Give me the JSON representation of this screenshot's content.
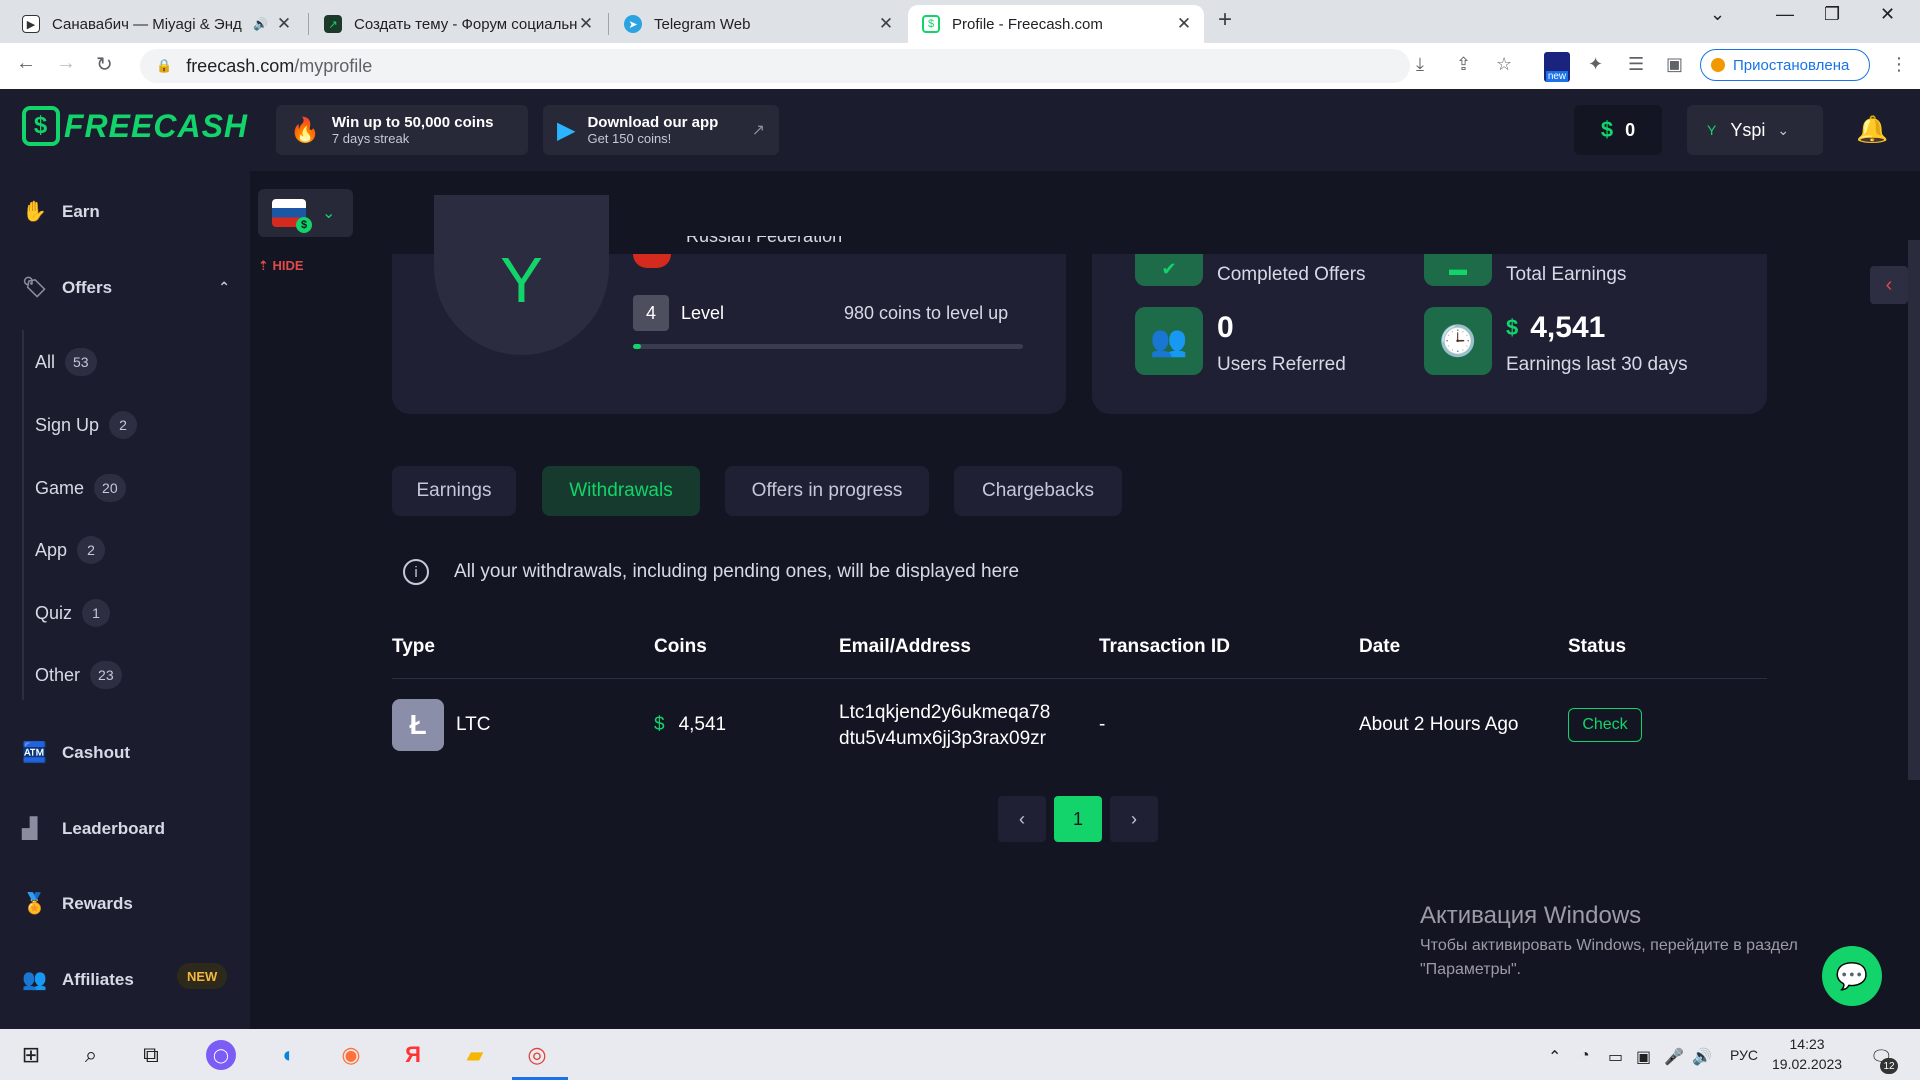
{
  "browser": {
    "tabs": [
      {
        "title": "Санавабич — Miyagi & Энд",
        "active": false
      },
      {
        "title": "Создать тему - Форум социальн",
        "active": false
      },
      {
        "title": "Telegram Web",
        "active": false
      },
      {
        "title": "Profile - Freecash.com",
        "active": true
      }
    ],
    "url_host": "freecash.com",
    "url_path": "/myprofile",
    "ext_badge": "new",
    "paused_label": "Приостановлена"
  },
  "header": {
    "logo": "FREECASH",
    "promos": [
      {
        "title": "Win up to 50,000 coins",
        "subtitle": "7 days streak"
      },
      {
        "title": "Download our app",
        "subtitle": "Get 150 coins!"
      }
    ],
    "coins": "0",
    "user_initial": "Y",
    "username": "Yspi"
  },
  "sidebar": {
    "earn": "Earn",
    "offers": "Offers",
    "offer_categories": [
      {
        "label": "All",
        "count": "53"
      },
      {
        "label": "Sign Up",
        "count": "2"
      },
      {
        "label": "Game",
        "count": "20"
      },
      {
        "label": "App",
        "count": "2"
      },
      {
        "label": "Quiz",
        "count": "1"
      },
      {
        "label": "Other",
        "count": "23"
      }
    ],
    "cashout": "Cashout",
    "leaderboard": "Leaderboard",
    "rewards": "Rewards",
    "affiliates": "Affiliates",
    "affiliates_badge": "NEW",
    "hide": "HIDE"
  },
  "profile": {
    "avatar_initial": "Y",
    "country": "Russian Federation",
    "level_number": "4",
    "level_label": "Level",
    "level_up_text": "980 coins to level up",
    "level_progress": 0.02
  },
  "stats": {
    "completed_offers_label": "Completed Offers",
    "total_earnings_label": "Total Earnings",
    "users_referred_value": "0",
    "users_referred_label": "Users Referred",
    "earnings_30_value": "4,541",
    "earnings_30_label": "Earnings last 30 days"
  },
  "tabs": [
    "Earnings",
    "Withdrawals",
    "Offers in progress",
    "Chargebacks"
  ],
  "active_tab": "Withdrawals",
  "info_text": "All your withdrawals, including pending ones, will be displayed here",
  "table": {
    "headers": [
      "Type",
      "Coins",
      "Email/Address",
      "Transaction ID",
      "Date",
      "Status"
    ],
    "rows": [
      {
        "type": "LTC",
        "coins": "4,541",
        "address_line1": "Ltc1qkjend2y6ukmeqa78",
        "address_line2": "dtu5v4umx6jj3p3rax09zr",
        "transaction_id": "-",
        "date": "About 2 Hours Ago",
        "status": "Check"
      }
    ]
  },
  "pagination": {
    "current": "1"
  },
  "windows_activation": {
    "title": "Активация Windows",
    "line1": "Чтобы активировать Windows, перейдите в раздел",
    "line2": "\"Параметры\"."
  },
  "taskbar": {
    "lang": "РУС",
    "time": "14:23",
    "date": "19.02.2023",
    "notifications": "12"
  },
  "colors": {
    "accent": "#12d46a",
    "bg": "#141522",
    "panel": "#1f2033",
    "danger": "#e04a4a"
  }
}
